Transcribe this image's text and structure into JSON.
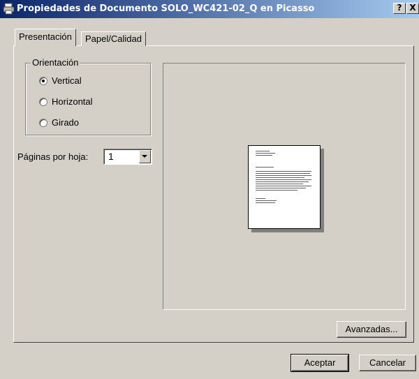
{
  "window": {
    "title": "Propiedades de Documento SOLO_WC421-02_Q en Picasso",
    "help_label": "?",
    "close_label": "X"
  },
  "tabs": [
    {
      "label": "Presentación",
      "active": true
    },
    {
      "label": "Papel/Calidad",
      "active": false
    }
  ],
  "orientation": {
    "legend": "Orientación",
    "options": [
      {
        "label": "Vertical",
        "checked": true
      },
      {
        "label": "Horizontal",
        "checked": false
      },
      {
        "label": "Girado",
        "checked": false
      }
    ]
  },
  "pages_per_sheet": {
    "label": "Páginas por hoja:",
    "value": "1"
  },
  "buttons": {
    "advanced": "Avanzadas...",
    "ok": "Aceptar",
    "cancel": "Cancelar"
  },
  "icons": {
    "title_icon": "printer-icon",
    "preview": "page-preview-icon"
  }
}
